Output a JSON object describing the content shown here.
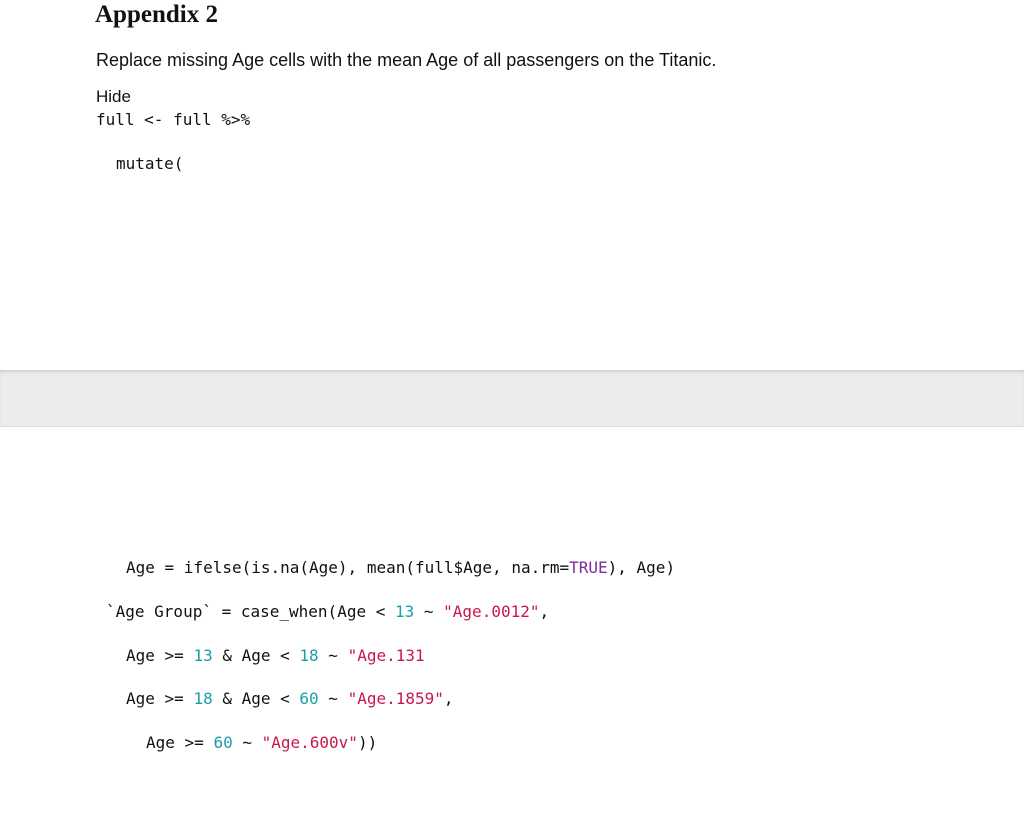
{
  "document": {
    "heading": "Appendix 2",
    "paragraph": "Replace missing Age cells with the mean Age of all passengers on the Titanic.",
    "hide_label": "Hide"
  },
  "code": {
    "line1": "full <- full %>%",
    "line2": "mutate(",
    "line3": {
      "a": "Age = ifelse(is.na(Age), mean(full$Age, na.rm=",
      "kw": "TRUE",
      "b": "), Age)"
    },
    "line4": {
      "a": "`Age Group` = case_when(Age < ",
      "n1": "13",
      "b": " ~ ",
      "s1": "\"Age.0012\"",
      "c": ","
    },
    "line5": {
      "a": "Age >= ",
      "n1": "13",
      "b": " & Age < ",
      "n2": "18",
      "c": " ~ ",
      "s1": "\"Age.131"
    },
    "line6": {
      "a": "Age >= ",
      "n1": "18",
      "b": " & Age < ",
      "n2": "60",
      "c": " ~ ",
      "s1": "\"Age.1859\"",
      "d": ","
    },
    "line7": {
      "a": "Age >= ",
      "n1": "60",
      "b": " ~ ",
      "s1": "\"Age.600v\"",
      "c": "))"
    }
  },
  "colors": {
    "number": "#1a9fa8",
    "string": "#c8174b",
    "keyword": "#7d2c9e",
    "page_gap": "#ececee"
  }
}
